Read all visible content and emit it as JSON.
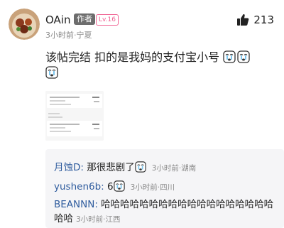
{
  "post": {
    "username": "OAin",
    "author_badge": "作者",
    "level_badge": "Lv.16",
    "meta": "3小时前·宁夏",
    "like_count": "213",
    "body_text": "该帖完结 扣的是我妈的支付宝小号",
    "body_emojis": [
      "cry-face-emoji",
      "cry-face-emoji",
      "cry-face-emoji"
    ]
  },
  "replies": [
    {
      "name": "月蚀D:",
      "text": "那很悲剧了",
      "emoji": "cry-face-emoji",
      "meta": "3小时前·湖南"
    },
    {
      "name": "yushen6b:",
      "text": "6",
      "emoji": "cry-face-emoji",
      "meta": "3小时前·四川"
    },
    {
      "name": "BEANNN:",
      "text": "哈哈哈哈哈哈哈哈哈哈哈哈哈哈哈哈哈哈哈哈",
      "meta": "3小时前·江西"
    }
  ],
  "colors": {
    "reply_name": "#2f5c9e",
    "level_badge": "#f06292",
    "author_badge_bg": "#6d6d6d",
    "meta_gray": "#8a8a8a",
    "reply_bg": "#f5f5f7"
  }
}
